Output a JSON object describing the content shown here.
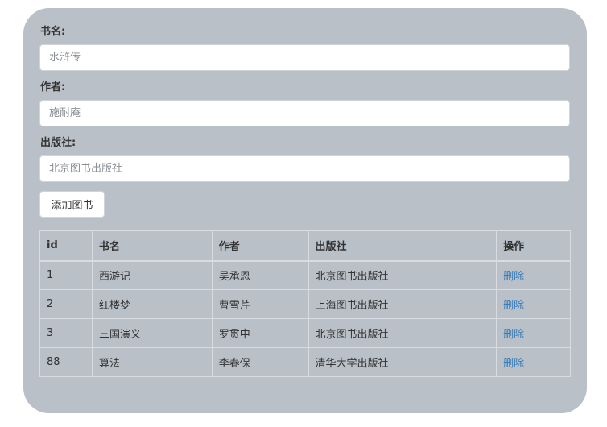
{
  "form": {
    "name_label": "书名:",
    "name_placeholder": "水浒传",
    "author_label": "作者:",
    "author_placeholder": "施耐庵",
    "publisher_label": "出版社:",
    "publisher_placeholder": "北京图书出版社",
    "add_button": "添加图书"
  },
  "table": {
    "headers": [
      "id",
      "书名",
      "作者",
      "出版社",
      "操作"
    ],
    "rows": [
      {
        "id": "1",
        "name": "西游记",
        "author": "吴承恩",
        "publisher": "北京图书出版社",
        "action": "删除"
      },
      {
        "id": "2",
        "name": "红楼梦",
        "author": "曹雪芹",
        "publisher": "上海图书出版社",
        "action": "删除"
      },
      {
        "id": "3",
        "name": "三国演义",
        "author": "罗贯中",
        "publisher": "北京图书出版社",
        "action": "删除"
      },
      {
        "id": "88",
        "name": "算法",
        "author": "李春保",
        "publisher": "清华大学出版社",
        "action": "删除"
      }
    ]
  },
  "colors": {
    "panel_background": "#b9c0c8",
    "link": "#337ab7"
  }
}
